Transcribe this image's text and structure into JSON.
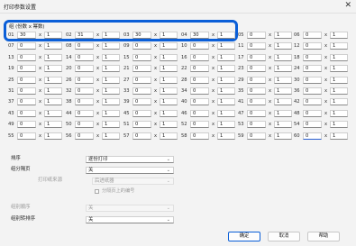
{
  "window": {
    "title": "打印参数设置",
    "close_glyph": "✕"
  },
  "grid": {
    "header_label": "组 (份数 x 幂数)",
    "times_symbol": "x",
    "rows": [
      [
        {
          "id": "01",
          "copies": "30",
          "power": "1"
        },
        {
          "id": "02",
          "copies": "31",
          "power": "1"
        },
        {
          "id": "03",
          "copies": "30",
          "power": "1"
        },
        {
          "id": "04",
          "copies": "30",
          "power": "1"
        },
        {
          "id": "05",
          "copies": "0",
          "power": "1"
        },
        {
          "id": "06",
          "copies": "0",
          "power": "1"
        }
      ],
      [
        {
          "id": "07",
          "copies": "0",
          "power": "1"
        },
        {
          "id": "08",
          "copies": "0",
          "power": "1"
        },
        {
          "id": "09",
          "copies": "0",
          "power": "1"
        },
        {
          "id": "10",
          "copies": "0",
          "power": "1"
        },
        {
          "id": "11",
          "copies": "0",
          "power": "1"
        },
        {
          "id": "12",
          "copies": "0",
          "power": "1"
        }
      ],
      [
        {
          "id": "13",
          "copies": "0",
          "power": "1"
        },
        {
          "id": "14",
          "copies": "0",
          "power": "1"
        },
        {
          "id": "15",
          "copies": "0",
          "power": "1"
        },
        {
          "id": "16",
          "copies": "0",
          "power": "1"
        },
        {
          "id": "17",
          "copies": "0",
          "power": "1"
        },
        {
          "id": "18",
          "copies": "0",
          "power": "1"
        }
      ],
      [
        {
          "id": "19",
          "copies": "0",
          "power": "1"
        },
        {
          "id": "20",
          "copies": "0",
          "power": "1"
        },
        {
          "id": "21",
          "copies": "0",
          "power": "1"
        },
        {
          "id": "22",
          "copies": "0",
          "power": "1"
        },
        {
          "id": "23",
          "copies": "0",
          "power": "1"
        },
        {
          "id": "24",
          "copies": "0",
          "power": "1"
        }
      ],
      [
        {
          "id": "25",
          "copies": "0",
          "power": "1"
        },
        {
          "id": "26",
          "copies": "0",
          "power": "1"
        },
        {
          "id": "27",
          "copies": "0",
          "power": "1"
        },
        {
          "id": "28",
          "copies": "0",
          "power": "1"
        },
        {
          "id": "29",
          "copies": "0",
          "power": "1"
        },
        {
          "id": "30",
          "copies": "0",
          "power": "1"
        }
      ],
      [
        {
          "id": "31",
          "copies": "0",
          "power": "1"
        },
        {
          "id": "32",
          "copies": "0",
          "power": "1"
        },
        {
          "id": "33",
          "copies": "0",
          "power": "1"
        },
        {
          "id": "34",
          "copies": "0",
          "power": "1"
        },
        {
          "id": "35",
          "copies": "0",
          "power": "1"
        },
        {
          "id": "36",
          "copies": "0",
          "power": "1"
        }
      ],
      [
        {
          "id": "37",
          "copies": "0",
          "power": "1"
        },
        {
          "id": "38",
          "copies": "0",
          "power": "1"
        },
        {
          "id": "39",
          "copies": "0",
          "power": "1"
        },
        {
          "id": "40",
          "copies": "0",
          "power": "1"
        },
        {
          "id": "41",
          "copies": "0",
          "power": "1"
        },
        {
          "id": "42",
          "copies": "0",
          "power": "1"
        }
      ],
      [
        {
          "id": "43",
          "copies": "0",
          "power": "1"
        },
        {
          "id": "44",
          "copies": "0",
          "power": "1"
        },
        {
          "id": "45",
          "copies": "0",
          "power": "1"
        },
        {
          "id": "46",
          "copies": "0",
          "power": "1"
        },
        {
          "id": "47",
          "copies": "0",
          "power": "1"
        },
        {
          "id": "48",
          "copies": "0",
          "power": "1"
        }
      ],
      [
        {
          "id": "49",
          "copies": "0",
          "power": "1"
        },
        {
          "id": "50",
          "copies": "0",
          "power": "1"
        },
        {
          "id": "51",
          "copies": "0",
          "power": "1"
        },
        {
          "id": "52",
          "copies": "0",
          "power": "1"
        },
        {
          "id": "53",
          "copies": "0",
          "power": "1"
        },
        {
          "id": "54",
          "copies": "0",
          "power": "1"
        }
      ],
      [
        {
          "id": "55",
          "copies": "0",
          "power": "1"
        },
        {
          "id": "56",
          "copies": "0",
          "power": "1"
        },
        {
          "id": "57",
          "copies": "0",
          "power": "1"
        },
        {
          "id": "58",
          "copies": "0",
          "power": "1"
        },
        {
          "id": "59",
          "copies": "0",
          "power": "1"
        },
        {
          "id": "60",
          "copies": "0",
          "power": "1"
        }
      ]
    ]
  },
  "settings": {
    "sort": {
      "label": "排序",
      "value": "逐份打印"
    },
    "separator": {
      "label": "组分隔页",
      "value": "关"
    },
    "print_source": {
      "label": "打印纸来源",
      "value": "后进纸器"
    },
    "print_number_checkbox": {
      "label": "分隔页上的编号"
    },
    "order": {
      "label": "组别顺序",
      "value": "关"
    },
    "collate": {
      "label": "组别转排序",
      "value": "关"
    }
  },
  "buttons": {
    "ok": "确定",
    "cancel": "取消",
    "help": "帮助"
  }
}
